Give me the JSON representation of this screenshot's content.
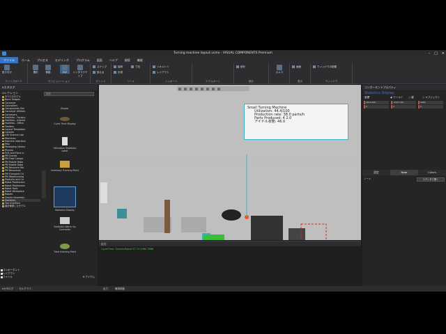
{
  "app": {
    "title": "Turning machine layout.vcmx - VISUAL COMPONENTS Premium"
  },
  "menu": [
    "ファイル",
    "ホーム",
    "プロセス",
    "モデリング",
    "プログラム",
    "図面",
    "ヘルプ",
    "接続",
    "機能"
  ],
  "ribbon_groups": [
    "クリップボード",
    "マニピュレーション",
    "グリッド",
    "ツール",
    "インポート",
    "エクスポート",
    "統計",
    "表示",
    "ウィンドウ"
  ],
  "ribbon_buttons": {
    "paste": "貼り付け",
    "select": "選択",
    "move": "移動",
    "interactive": "インタラクティブ",
    "snap": "スナップ",
    "align": "揃える",
    "pnp": "PnP",
    "connect_label": "接続",
    "geometry": "ジオメトリ",
    "layout": "レイアウト",
    "statistics": "統計",
    "dimension": "寸法",
    "measure": "計測",
    "camera": "カメラ",
    "screen": "画面",
    "window": "ウィンドウ",
    "selection_label": "選択",
    "snap_label": "スナップ",
    "window_layout": "ウィンドウの配置"
  },
  "left_panel": {
    "header": "eカタログ",
    "collections_label": "コレクション",
    "search_placeholder": "検索",
    "tree": [
      "すべてのモデル",
      "Basic Shapes",
      "Conveyor",
      "Controllers",
      "Components Sim",
      "Conveyor Utilities",
      "Conveyors",
      "Facilities - Factory",
      "Facilities - Interior",
      "Facilities - Office",
      "Feeders",
      "Layout Templates",
      "Layouts",
      "Life Science Lab",
      "Machines",
      "Machine Interface",
      "Misc",
      "Packaging Library",
      "Physics",
      "Pick and Place Li",
      "PM Cranes",
      "PM Flow Compo",
      "PM Mobile Robo",
      "PM Mobile Robo",
      "PM Resource Ma",
      "PM Resources",
      "PM Transport Co",
      "PM Warehousing",
      "Products and Co",
      "Robot Positioners",
      "Robot Positioners",
      "Robot Tools",
      "Robot Workplace",
      "Robots",
      "Simple Assembly",
      "Statistics",
      "Tool Interface",
      "最近使用したモデル"
    ],
    "gallery": [
      "Buzzer",
      "Cycle Time Display",
      "Utilization Statistics Label",
      "Inventory Tracking Point",
      "Statistics Display",
      "Statistics Warm Up Controller",
      "Time tracking Point"
    ],
    "checkboxes": [
      "コンポーネント",
      "レイアウト",
      "ファイル"
    ],
    "items_count": "6 アイテム"
  },
  "bottom_tabs": [
    "eカタログ",
    "セルグラフ"
  ],
  "bottom_center_tabs": [
    "出力",
    "機械調査"
  ],
  "viewport": {
    "info_lines": [
      "Small Turning Machine",
      "Utilization: 44.4/100",
      "Production rate: 38.0 parts/h",
      "Parts Produced: 4 2.0",
      "アイドル状態: 46.0"
    ]
  },
  "output": {
    "header": "出力",
    "line": "CycleTime: GenericRobot ST 75.1964 7886"
  },
  "right_panel": {
    "header": "コンポーネントプロパティ",
    "component_name": "Statistics Display",
    "coord_label": "座標",
    "world_label": "ワールド",
    "parent_label": "親",
    "object_label": "オブジェクト",
    "fields": [
      "3810.630",
      "-3347.097",
      "2960",
      "0",
      "0",
      "0"
    ],
    "tabs": [
      "設定",
      "Note",
      "Colors"
    ],
    "note_label": "ノート",
    "edit_button": "エディタで開く"
  }
}
